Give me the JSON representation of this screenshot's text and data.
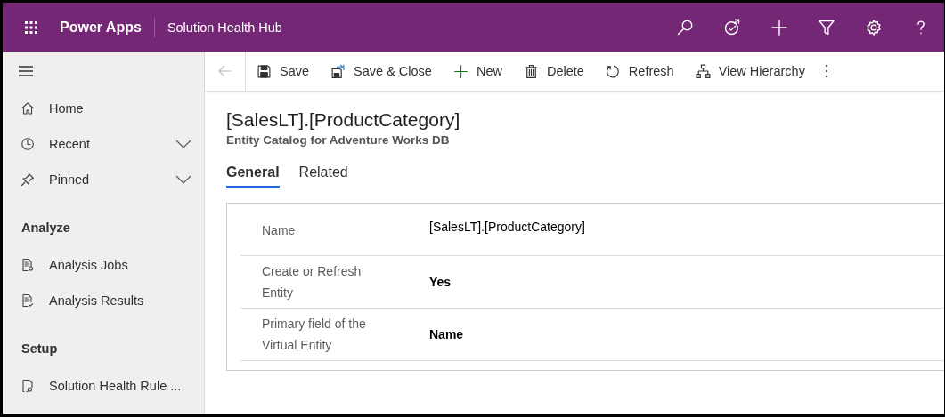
{
  "header": {
    "app_name": "Power Apps",
    "area_name": "Solution Health Hub"
  },
  "sidebar": {
    "items": [
      {
        "label": "Home"
      },
      {
        "label": "Recent",
        "expanded": false
      },
      {
        "label": "Pinned",
        "expanded": false
      }
    ],
    "groups": [
      {
        "title": "Analyze",
        "items": [
          {
            "label": "Analysis Jobs"
          },
          {
            "label": "Analysis Results"
          }
        ]
      },
      {
        "title": "Setup",
        "items": [
          {
            "label": "Solution Health Rule ..."
          }
        ]
      }
    ]
  },
  "toolbar": {
    "buttons": [
      {
        "label": "Save"
      },
      {
        "label": "Save & Close"
      },
      {
        "label": "New"
      },
      {
        "label": "Delete"
      },
      {
        "label": "Refresh"
      },
      {
        "label": "View Hierarchy"
      }
    ]
  },
  "record": {
    "title": "[SalesLT].[ProductCategory]",
    "subtitle": "Entity Catalog for Adventure Works DB"
  },
  "tabs": [
    {
      "label": "General",
      "selected": true
    },
    {
      "label": "Related",
      "selected": false
    }
  ],
  "fields": [
    {
      "label": "Name",
      "value": "[SalesLT].[ProductCategory]",
      "bold": false
    },
    {
      "label": "Create or Refresh Entity",
      "value": "Yes",
      "bold": true
    },
    {
      "label": "Primary field of the Virtual Entity",
      "value": "Name",
      "bold": true
    }
  ]
}
